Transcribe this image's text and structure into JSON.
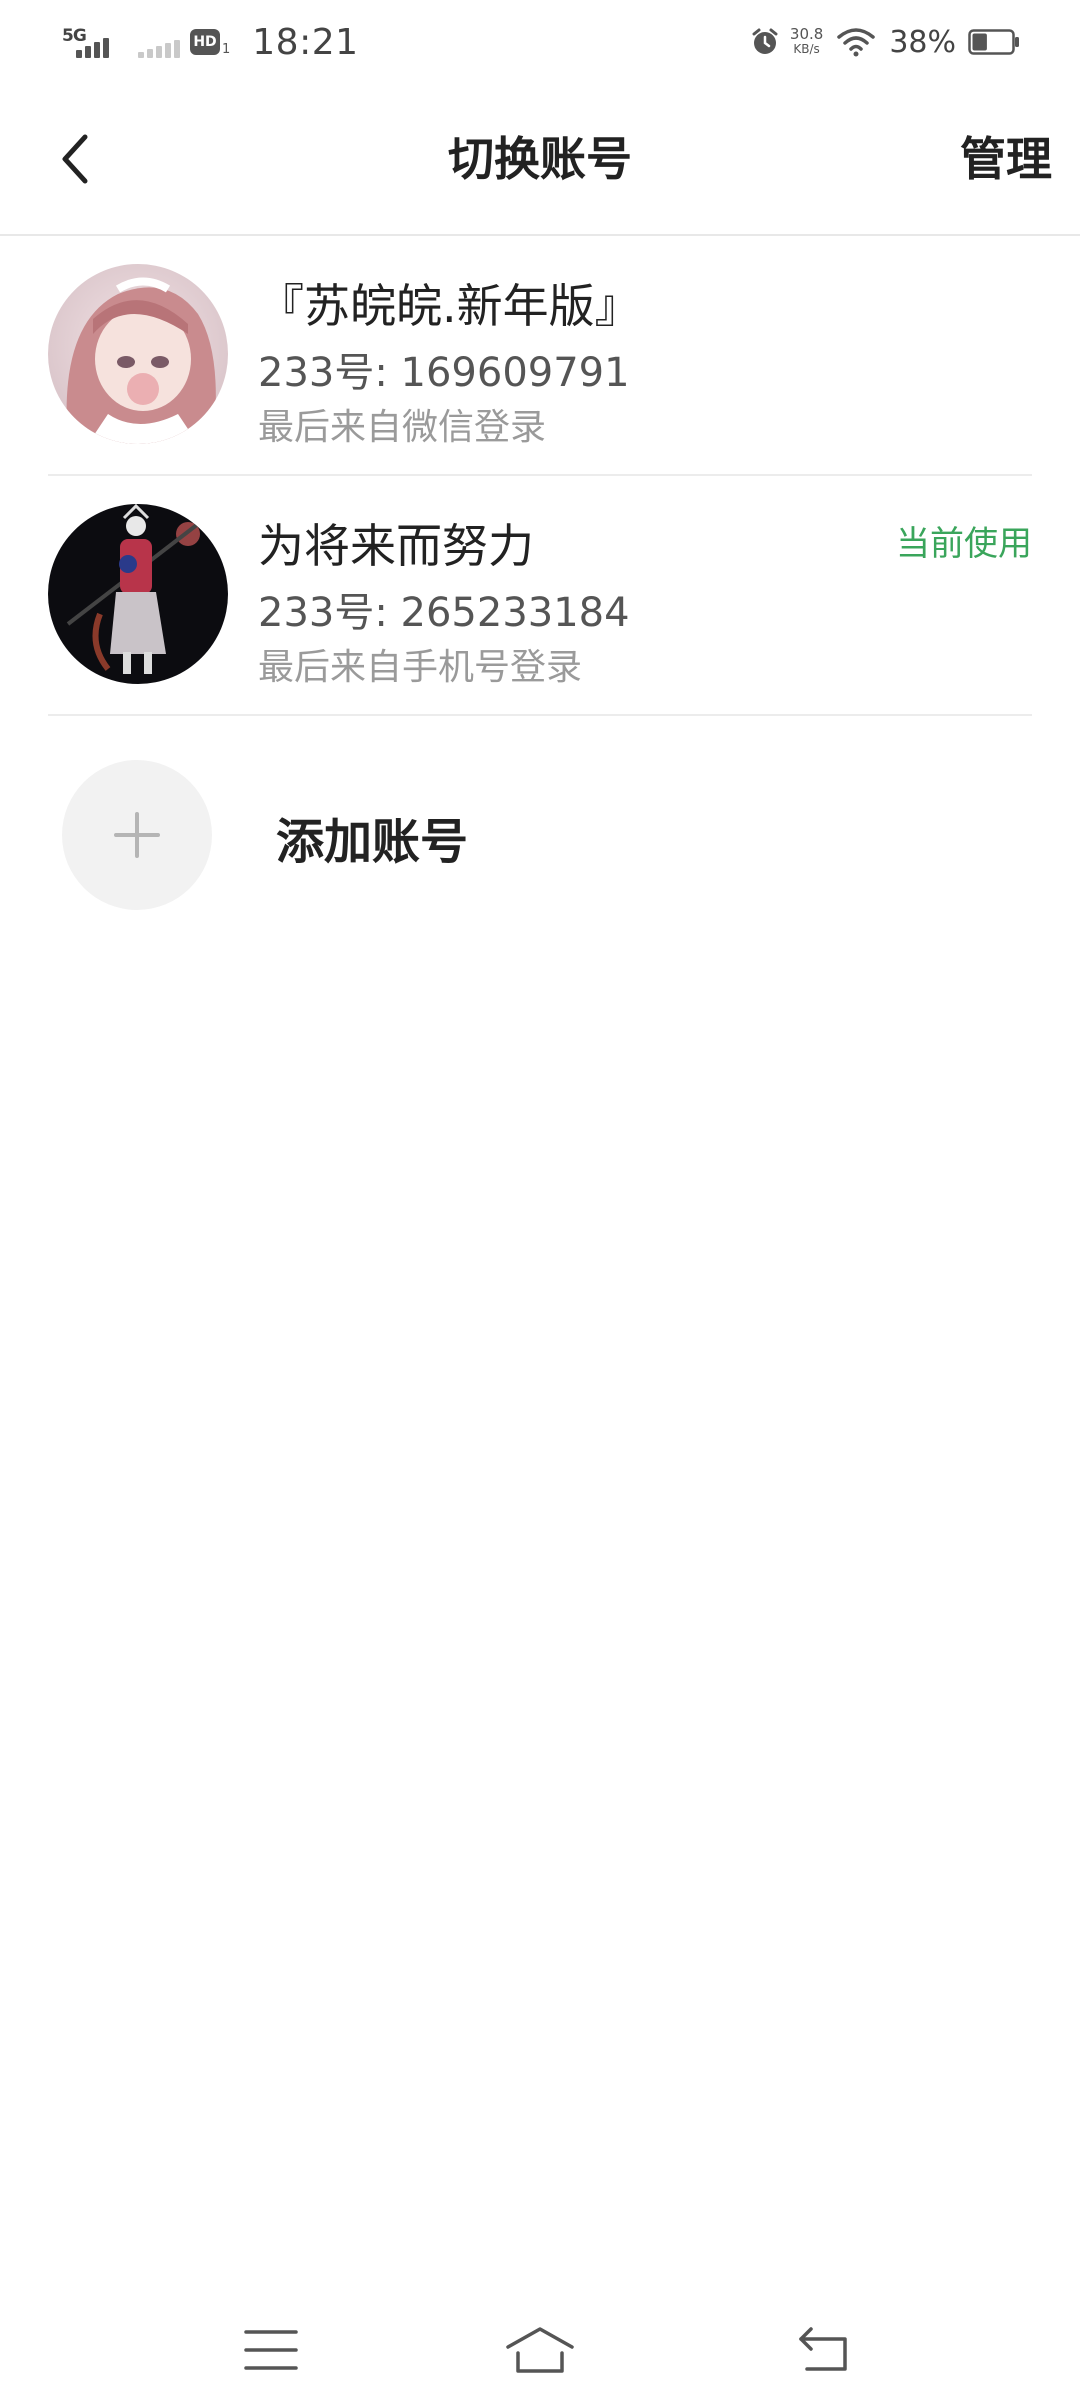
{
  "status_bar": {
    "network_label": "5G",
    "hd_label": "HD",
    "hd_sub": "1",
    "time": "18:21",
    "net_speed_value": "30.8",
    "net_speed_unit": "KB/s",
    "battery_percent": "38%",
    "battery_level": 0.38
  },
  "header": {
    "title": "切换账号",
    "manage_label": "管理"
  },
  "accounts": [
    {
      "name": "『苏皖皖.新年版』",
      "id_text": "233号: 169609791",
      "login_text": "最后来自微信登录",
      "current_label": ""
    },
    {
      "name": "为将来而努力",
      "id_text": "233号: 265233184",
      "login_text": "最后来自手机号登录",
      "current_label": "当前使用"
    }
  ],
  "add_account": {
    "label": "添加账号"
  },
  "icons": {
    "back": "chevron-left-icon",
    "add": "plus-icon",
    "menu": "menu-icon",
    "home": "home-icon",
    "return": "return-icon"
  },
  "colors": {
    "accent_green": "#3aa55b",
    "text_primary": "#222222",
    "text_secondary": "#9a9a9a"
  }
}
